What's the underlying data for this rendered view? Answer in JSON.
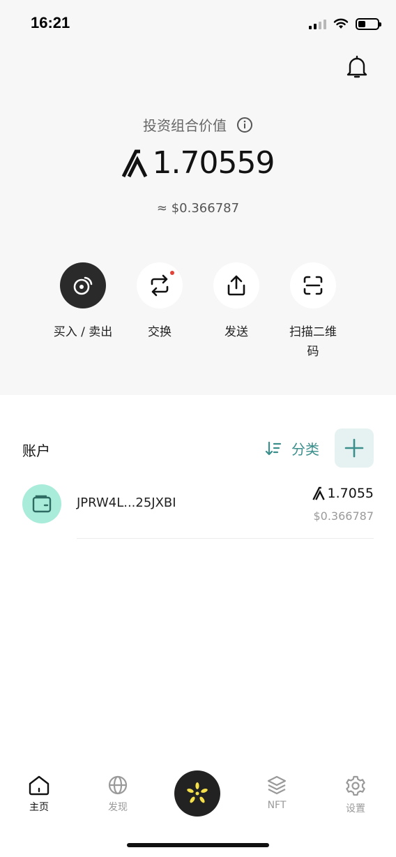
{
  "status_bar": {
    "time": "16:21"
  },
  "portfolio": {
    "label": "投资组合价值",
    "balance": "1.70559",
    "fiat_value": "≈ $0.366787"
  },
  "actions": [
    {
      "label": "买入 / 卖出",
      "icon": "buy-sell-icon"
    },
    {
      "label": "交换",
      "icon": "swap-icon"
    },
    {
      "label": "发送",
      "icon": "send-icon"
    },
    {
      "label": "扫描二维码",
      "icon": "scan-qr-icon"
    }
  ],
  "accounts": {
    "title": "账户",
    "sort_label": "分类",
    "items": [
      {
        "name": "JPRW4L...25JXBI",
        "balance": "1.7055",
        "fiat": "$0.366787"
      }
    ]
  },
  "tabbar": [
    {
      "label": "主页",
      "icon": "home-icon",
      "active": true
    },
    {
      "label": "发现",
      "icon": "globe-icon",
      "active": false
    },
    {
      "label": "",
      "icon": "logo-icon",
      "active": false
    },
    {
      "label": "NFT",
      "icon": "layers-icon",
      "active": false
    },
    {
      "label": "设置",
      "icon": "gear-icon",
      "active": false
    }
  ],
  "colors": {
    "accent": "#3a8f8c",
    "notification_dot": "#e0433a",
    "avatar_bg": "#a8ecd9",
    "logo_yellow": "#f5e04a"
  }
}
